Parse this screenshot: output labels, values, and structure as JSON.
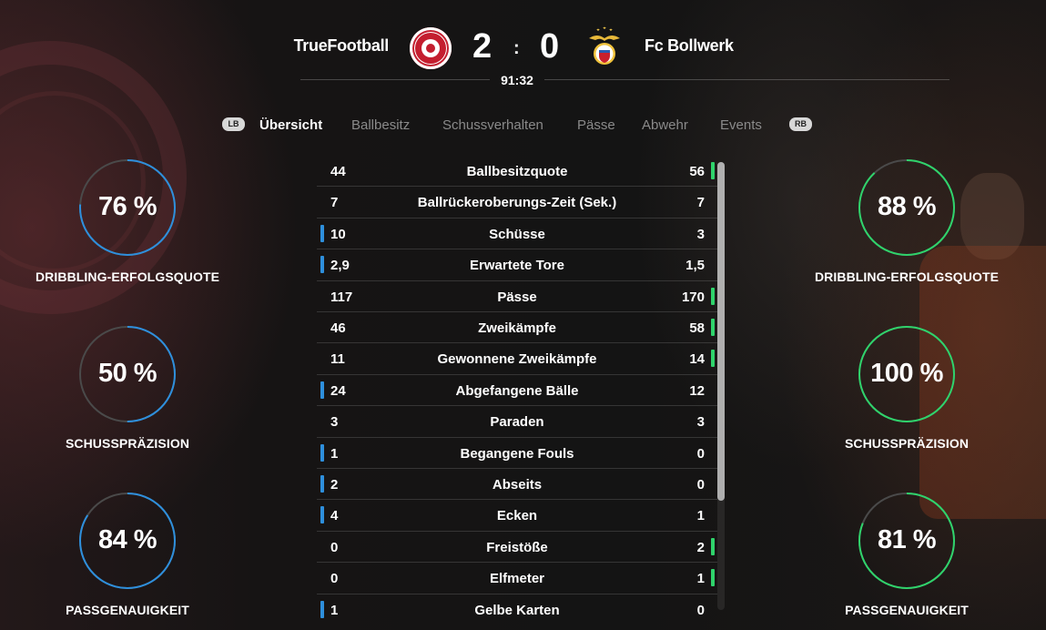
{
  "header": {
    "home_team": "TrueFootball",
    "away_team": "Fc Bollwerk",
    "home_score": "2",
    "separator": ":",
    "away_score": "0",
    "match_time": "91:32"
  },
  "tabs": {
    "left_bumper": "LB",
    "right_bumper": "RB",
    "items": [
      {
        "label": "Übersicht",
        "active": true
      },
      {
        "label": "Ballbesitz",
        "active": false
      },
      {
        "label": "Schussverhalten",
        "active": false
      },
      {
        "label": "Pässe",
        "active": false
      },
      {
        "label": "Abwehr",
        "active": false
      },
      {
        "label": "Events",
        "active": false
      }
    ]
  },
  "colors": {
    "home_accent": "#2e8fdc",
    "away_accent": "#2fd36b",
    "home_crest": "#c41e2f"
  },
  "home_rings": [
    {
      "value": "76 %",
      "pct": 76,
      "label": "DRIBBLING-ERFOLGSQUOTE"
    },
    {
      "value": "50 %",
      "pct": 50,
      "label": "SCHUSSPRÄZISION"
    },
    {
      "value": "84 %",
      "pct": 84,
      "label": "PASSGENAUIGKEIT"
    }
  ],
  "away_rings": [
    {
      "value": "88 %",
      "pct": 88,
      "label": "DRIBBLING-ERFOLGSQUOTE"
    },
    {
      "value": "100 %",
      "pct": 100,
      "label": "SCHUSSPRÄZISION"
    },
    {
      "value": "81 %",
      "pct": 81,
      "label": "PASSGENAUIGKEIT"
    }
  ],
  "stats": [
    {
      "name": "Ballbesitzquote",
      "home": "44",
      "away": "56",
      "lead": "away"
    },
    {
      "name": "Ballrückeroberungs-Zeit (Sek.)",
      "home": "7",
      "away": "7",
      "lead": "none"
    },
    {
      "name": "Schüsse",
      "home": "10",
      "away": "3",
      "lead": "home"
    },
    {
      "name": "Erwartete Tore",
      "home": "2,9",
      "away": "1,5",
      "lead": "home"
    },
    {
      "name": "Pässe",
      "home": "117",
      "away": "170",
      "lead": "away"
    },
    {
      "name": "Zweikämpfe",
      "home": "46",
      "away": "58",
      "lead": "away"
    },
    {
      "name": "Gewonnene Zweikämpfe",
      "home": "11",
      "away": "14",
      "lead": "away"
    },
    {
      "name": "Abgefangene Bälle",
      "home": "24",
      "away": "12",
      "lead": "home"
    },
    {
      "name": "Paraden",
      "home": "3",
      "away": "3",
      "lead": "none"
    },
    {
      "name": "Begangene Fouls",
      "home": "1",
      "away": "0",
      "lead": "home"
    },
    {
      "name": "Abseits",
      "home": "2",
      "away": "0",
      "lead": "home"
    },
    {
      "name": "Ecken",
      "home": "4",
      "away": "1",
      "lead": "home"
    },
    {
      "name": "Freistöße",
      "home": "0",
      "away": "2",
      "lead": "away"
    },
    {
      "name": "Elfmeter",
      "home": "0",
      "away": "1",
      "lead": "away"
    },
    {
      "name": "Gelbe Karten",
      "home": "1",
      "away": "0",
      "lead": "home"
    }
  ]
}
